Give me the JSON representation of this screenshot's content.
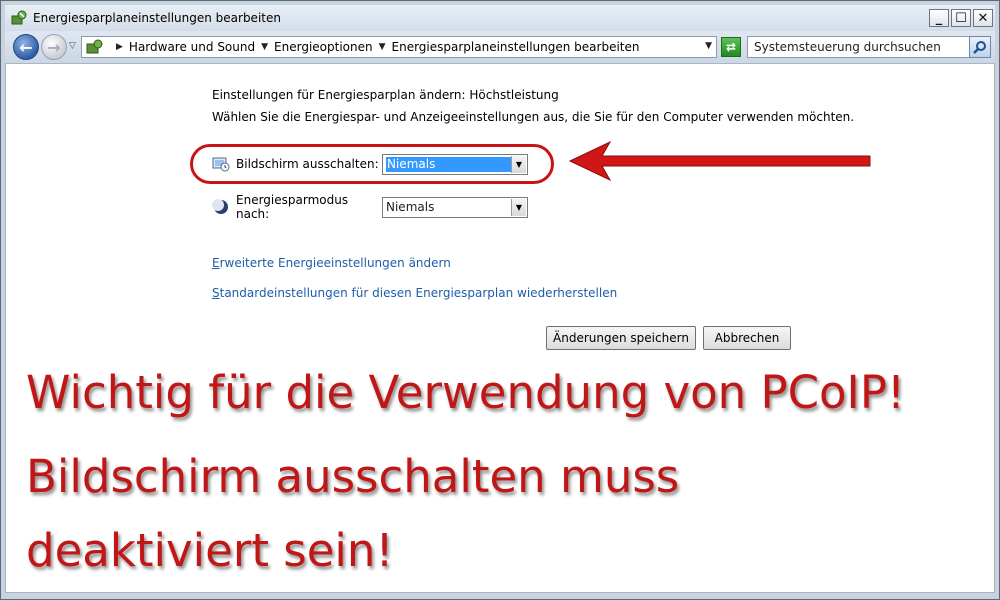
{
  "window": {
    "title": "Energiesparplaneinstellungen bearbeiten",
    "buttons": {
      "minimize": "_",
      "maximize": "☐",
      "close": "✕"
    }
  },
  "navbar": {
    "breadcrumbs": [
      "Hardware und Sound",
      "Energieoptionen",
      "Energiesparplaneinstellungen bearbeiten"
    ],
    "search_placeholder": "Systemsteuerung durchsuchen"
  },
  "content": {
    "heading": "Einstellungen für Energiesparplan ändern: Höchstleistung",
    "subheading": "Wählen Sie die Energiespar- und Anzeigeeinstellungen aus, die Sie für den Computer verwenden möchten.",
    "settings": [
      {
        "label": "Bildschirm ausschalten:",
        "value": "Niemals",
        "icon": "monitor-clock-icon"
      },
      {
        "label": "Energiesparmodus nach:",
        "value": "Niemals",
        "icon": "moon-icon"
      }
    ],
    "links": {
      "advanced_first": "E",
      "advanced_rest": "rweiterte Energieeinstellungen ändern",
      "restore_first": "S",
      "restore_rest": "tandardeinstellungen für diesen Energiesparplan wiederherstellen"
    },
    "buttons": {
      "save": "Änderungen speichern",
      "cancel": "Abbrechen"
    }
  },
  "annotation": {
    "color": "#c11616",
    "lines": [
      "Wichtig für die Verwendung von PCoIP!",
      "Bildschirm ausschalten muss",
      "deaktiviert sein!"
    ]
  }
}
